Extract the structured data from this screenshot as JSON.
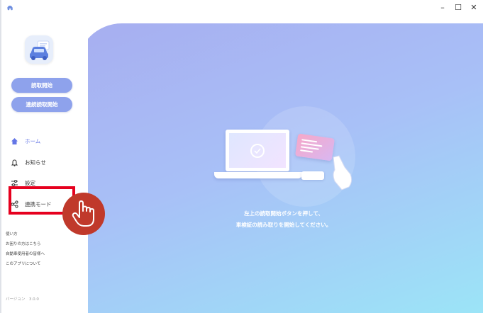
{
  "window": {
    "controls": {
      "minimize": "–",
      "maximize": "☐",
      "close": "✕"
    }
  },
  "sidebar": {
    "buttons": {
      "start_read": "読取開始",
      "continuous_read": "連続読取開始"
    },
    "nav": [
      {
        "label": "ホーム",
        "icon": "home-icon",
        "active": true
      },
      {
        "label": "お知らせ",
        "icon": "bell-icon",
        "active": false
      },
      {
        "label": "設定",
        "icon": "settings-icon",
        "active": false
      },
      {
        "label": "連携モード",
        "icon": "share-icon",
        "active": false
      }
    ],
    "links": [
      "使い方",
      "お困りの方はこちら",
      "自動車使用者の皆様へ",
      "このアプリについて"
    ],
    "version": "バージョン　3.0.0"
  },
  "main": {
    "instruction_line1": "左上の読取開始ボタンを押して、",
    "instruction_line2": "車検証の読み取りを開始してください。"
  },
  "colors": {
    "accent": "#8ea2ec",
    "active_nav": "#6476e6",
    "highlight": "#e6001e",
    "pointer": "#c0392b"
  }
}
